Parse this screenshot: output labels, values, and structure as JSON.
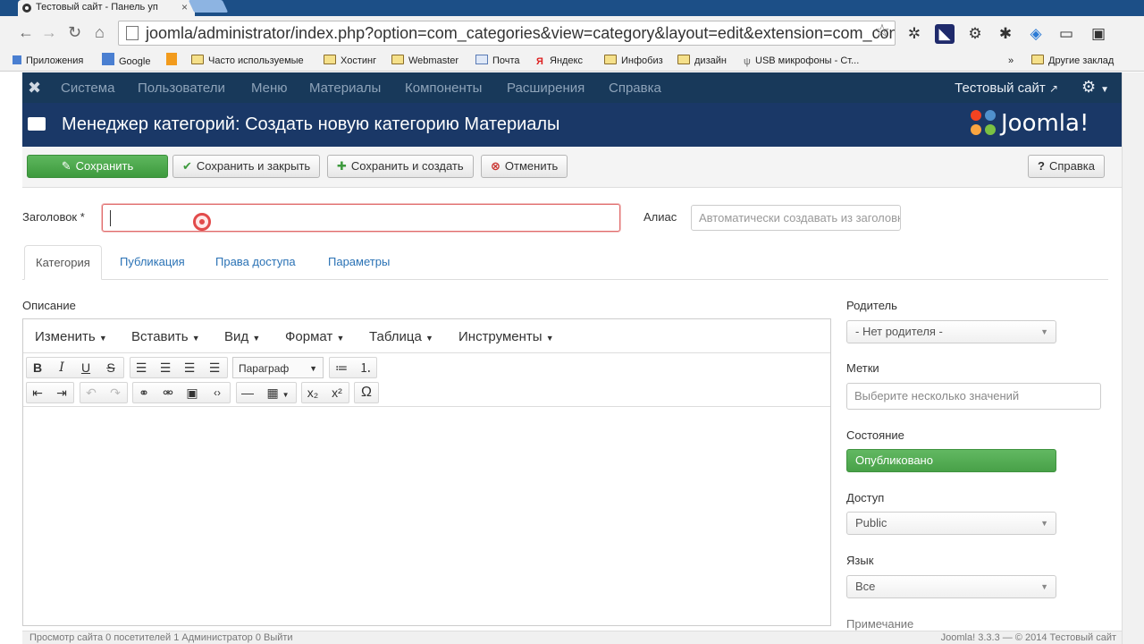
{
  "browser": {
    "tab_title": "Тестовый сайт - Панель уп",
    "tab_close": "×",
    "url": "joomla/administrator/index.php?option=com_categories&view=category&layout=edit&extension=com_cont",
    "bookmarks": [
      "Приложения",
      "Google",
      "Часто используемые",
      "Хостинг",
      "Webmaster",
      "Почта",
      "Яндекс",
      "Инфобиз",
      "дизайн",
      "USB микрофоны - Ст..."
    ],
    "bookmarks_more": "»",
    "other_bookmarks": "Другие заклад"
  },
  "nav": {
    "items": [
      "Система",
      "Пользователи",
      "Меню",
      "Материалы",
      "Компоненты",
      "Расширения",
      "Справка"
    ],
    "site_link": "Тестовый сайт"
  },
  "header": {
    "title": "Менеджер категорий: Создать новую категорию Материалы",
    "brand": "Joomla!"
  },
  "toolbar": {
    "save": "Сохранить",
    "save_close": "Сохранить и закрыть",
    "save_new": "Сохранить и создать",
    "cancel": "Отменить",
    "help": "Справка"
  },
  "form": {
    "title_label": "Заголовок *",
    "title_value": "",
    "alias_label": "Алиас",
    "alias_placeholder": "Автоматически создавать из заголовка",
    "tabs": [
      "Категория",
      "Публикация",
      "Права доступа",
      "Параметры"
    ],
    "description_label": "Описание"
  },
  "editor": {
    "menu": [
      "Изменить",
      "Вставить",
      "Вид",
      "Формат",
      "Таблица",
      "Инструменты"
    ],
    "format_select": "Параграф"
  },
  "sidebar": {
    "parent_label": "Родитель",
    "parent_value": "- Нет родителя -",
    "tags_label": "Метки",
    "tags_placeholder": "Выберите несколько значений",
    "state_label": "Состояние",
    "state_value": "Опубликовано",
    "access_label": "Доступ",
    "access_value": "Public",
    "language_label": "Язык",
    "language_value": "Все",
    "note_label": "Примечание"
  },
  "footer": {
    "text": "Просмотр сайта  0 посетителей  1 Администратор  0  Выйти",
    "version": "Joomla! 3.3.3  —  © 2014 Тестовый сайт"
  },
  "colors": {
    "nav_bg": "#18395a",
    "header_bg": "#1a3867",
    "primary_green": "#46a546",
    "link_blue": "#2a72b5",
    "error_red": "#e06b6b"
  }
}
